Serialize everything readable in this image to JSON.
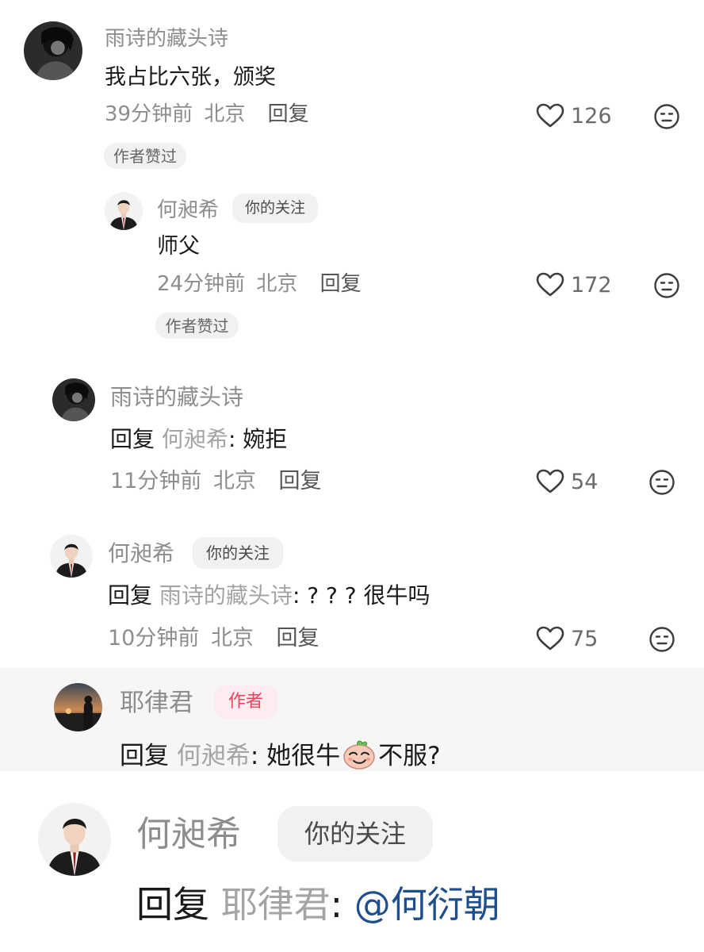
{
  "comments": [
    {
      "name": "雨诗的藏头诗",
      "text": "我占比六张，颁奖",
      "time": "39分钟前",
      "location": "北京",
      "reply_label": "回复",
      "likes": "126",
      "liked_badge": "作者赞过",
      "avatar": "dark-hair-photo"
    },
    {
      "name": "何昶希",
      "tag": "你的关注",
      "text": "师父",
      "time": "24分钟前",
      "location": "北京",
      "reply_label": "回复",
      "likes": "172",
      "liked_badge": "作者赞过",
      "avatar": "suit-portrait"
    },
    {
      "name": "雨诗的藏头诗",
      "reply_prefix": "回复",
      "reply_target": "何昶希",
      "text": ": 婉拒",
      "time": "11分钟前",
      "location": "北京",
      "reply_label": "回复",
      "likes": "54",
      "avatar": "dark-hair-photo"
    },
    {
      "name": "何昶希",
      "tag": "你的关注",
      "reply_prefix": "回复",
      "reply_target": "雨诗的藏头诗",
      "text": ": ? ? ?  很牛吗",
      "time": "10分钟前",
      "location": "北京",
      "reply_label": "回复",
      "likes": "75",
      "avatar": "suit-portrait"
    },
    {
      "name": "耶律君",
      "tag": "作者",
      "reply_prefix": "回复",
      "reply_target": "何昶希",
      "text_before_emoji": ": 她很牛",
      "text_after_emoji": "不服?",
      "emoji": "smug-face-emoji",
      "avatar": "sunset-silhouette"
    },
    {
      "name": "何昶希",
      "tag": "你的关注",
      "reply_prefix": "回复",
      "reply_target": "耶律君",
      "colon": ": ",
      "mention": "@何衍朝",
      "avatar": "suit-portrait"
    }
  ],
  "icons": {
    "like": "heart-outline-icon",
    "react": "neutral-face-icon"
  },
  "colors": {
    "name_gray": "#8d8d8d",
    "author_tag": "#f0415c",
    "mention_blue": "#1f4e8c"
  }
}
